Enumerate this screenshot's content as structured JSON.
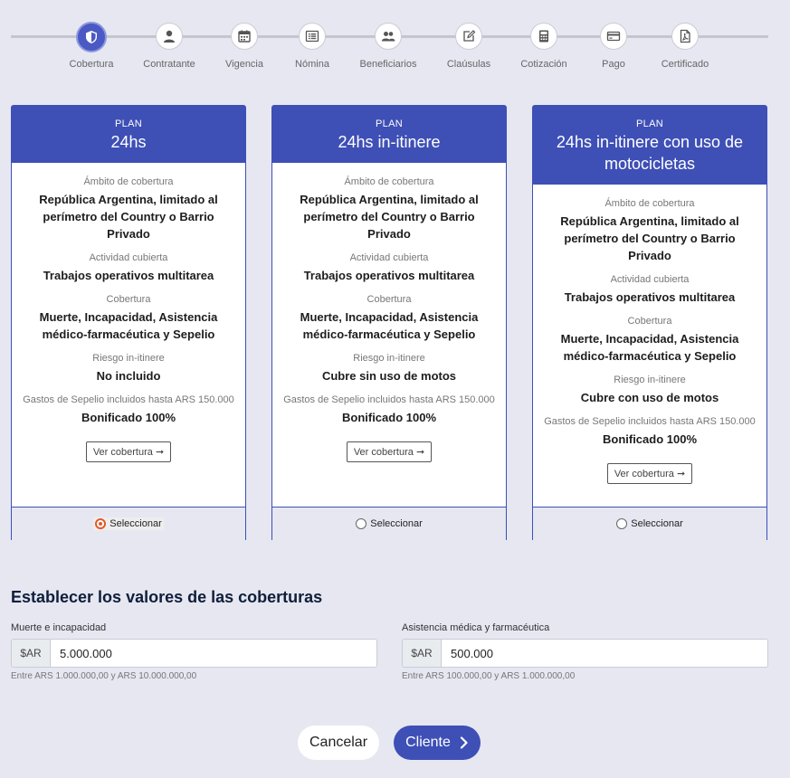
{
  "stepper": {
    "steps": [
      {
        "label": "Cobertura",
        "icon": "shield-icon"
      },
      {
        "label": "Contratante",
        "icon": "user-icon"
      },
      {
        "label": "Vigencia",
        "icon": "calendar-icon"
      },
      {
        "label": "Nómina",
        "icon": "list-icon"
      },
      {
        "label": "Beneficiarios",
        "icon": "users-icon"
      },
      {
        "label": "Claúsulas",
        "icon": "edit-icon"
      },
      {
        "label": "Cotización",
        "icon": "calculator-icon"
      },
      {
        "label": "Pago",
        "icon": "credit-card-icon"
      },
      {
        "label": "Certificado",
        "icon": "pdf-file-icon"
      }
    ],
    "active_index": 0
  },
  "plans": [
    {
      "kicker": "PLAN",
      "name": "24hs",
      "fields": [
        {
          "label": "Ámbito de cobertura",
          "value": "República Argentina, limitado al perímetro del Country o Barrio Privado"
        },
        {
          "label": "Actividad cubierta",
          "value": "Trabajos operativos multitarea"
        },
        {
          "label": "Cobertura",
          "value": "Muerte, Incapacidad, Asistencia médico-farmacéutica y Sepelio"
        },
        {
          "label": "Riesgo in-itinere",
          "value": "No incluido"
        },
        {
          "label": "Gastos de Sepelio incluidos hasta ARS 150.000",
          "value": "Bonificado 100%"
        }
      ],
      "button_label": "Ver cobertura",
      "select_label": "Seleccionar",
      "selected": true
    },
    {
      "kicker": "PLAN",
      "name": "24hs in-itinere",
      "fields": [
        {
          "label": "Ámbito de cobertura",
          "value": "República Argentina, limitado al perímetro del Country o Barrio Privado"
        },
        {
          "label": "Actividad cubierta",
          "value": "Trabajos operativos multitarea"
        },
        {
          "label": "Cobertura",
          "value": "Muerte, Incapacidad, Asistencia médico-farmacéutica y Sepelio"
        },
        {
          "label": "Riesgo in-itinere",
          "value": "Cubre sin uso de motos"
        },
        {
          "label": "Gastos de Sepelio incluidos hasta ARS 150.000",
          "value": "Bonificado 100%"
        }
      ],
      "button_label": "Ver cobertura",
      "select_label": "Seleccionar",
      "selected": false
    },
    {
      "kicker": "PLAN",
      "name": "24hs in-itinere con uso de motocicletas",
      "fields": [
        {
          "label": "Ámbito de cobertura",
          "value": "República Argentina, limitado al perímetro del Country o Barrio Privado"
        },
        {
          "label": "Actividad cubierta",
          "value": "Trabajos operativos multitarea"
        },
        {
          "label": "Cobertura",
          "value": "Muerte, Incapacidad, Asistencia médico-farmacéutica y Sepelio"
        },
        {
          "label": "Riesgo in-itinere",
          "value": "Cubre con uso de motos"
        },
        {
          "label": "Gastos de Sepelio incluidos hasta ARS 150.000",
          "value": "Bonificado 100%"
        }
      ],
      "button_label": "Ver cobertura",
      "select_label": "Seleccionar",
      "selected": false
    }
  ],
  "values_section": {
    "title": "Establecer los valores de las coberturas",
    "fields": [
      {
        "label": "Muerte e incapacidad",
        "prefix": "$AR",
        "value": "5.000.000",
        "help": "Entre ARS 1.000.000,00 y ARS 10.000.000,00"
      },
      {
        "label": "Asistencia médica y farmacéutica",
        "prefix": "$AR",
        "value": "500.000",
        "help": "Entre ARS 100.000,00 y ARS 1.000.000,00"
      }
    ]
  },
  "actions": {
    "cancel_label": "Cancelar",
    "next_label": "Cliente"
  },
  "colors": {
    "primary": "#3e4fb6",
    "background": "#e6e7f1",
    "radio_selected": "#e25a26"
  }
}
